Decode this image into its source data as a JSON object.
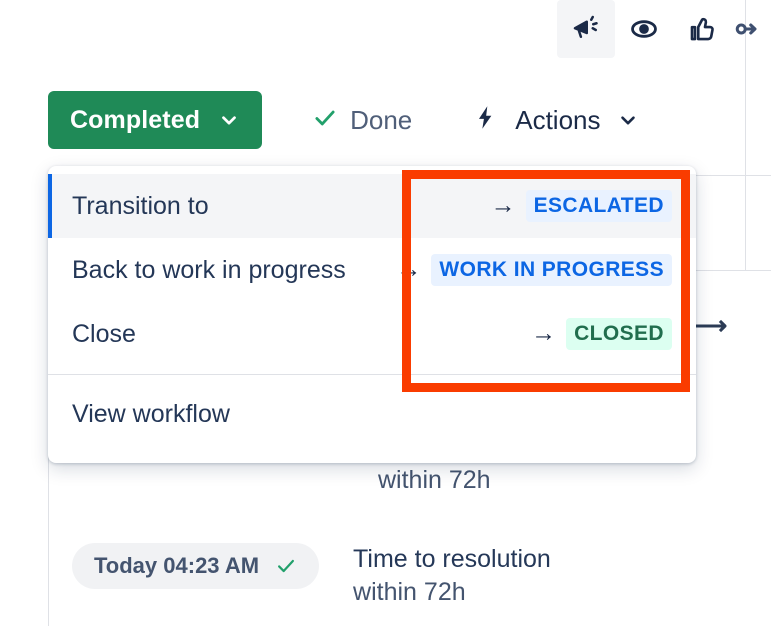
{
  "toolbar": {
    "icons": [
      {
        "name": "megaphone-icon",
        "label": "Announce",
        "active": true
      },
      {
        "name": "eye-icon",
        "label": "Watch",
        "active": false
      },
      {
        "name": "thumbs-up-icon",
        "label": "Like",
        "active": false
      },
      {
        "name": "link-icon",
        "label": "Copy link",
        "active": false
      }
    ]
  },
  "action_bar": {
    "status_label": "Completed",
    "status_color": "#1f8a57",
    "done_label": "Done",
    "actions_label": "Actions"
  },
  "dropdown": {
    "items": [
      {
        "label": "Transition to",
        "arrow": "→",
        "badge": "ESCALATED",
        "badge_style": "blue",
        "hovered": true
      },
      {
        "label": "Back to work in progress",
        "arrow": "→",
        "badge": "WORK IN PROGRESS",
        "badge_style": "blue",
        "hovered": false
      },
      {
        "label": "Close",
        "arrow": "→",
        "badge": "CLOSED",
        "badge_style": "green",
        "hovered": false
      }
    ],
    "footer_label": "View workflow"
  },
  "annotation": {
    "highlight_color": "#fa3c00"
  },
  "background": {
    "clipped_sla_text": "within 72h",
    "sla_row": {
      "time": "Today 04:23 AM",
      "check": "✓",
      "title": "Time to resolution",
      "subtitle": "within 72h"
    }
  }
}
